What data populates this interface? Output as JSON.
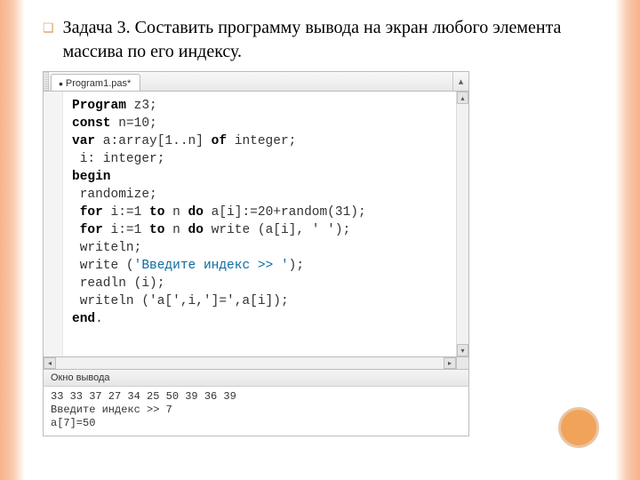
{
  "task": {
    "bullet": "❑",
    "text": "Задача 3. Составить программу вывода на экран любого элемента массива по его индексу."
  },
  "ide": {
    "tab_label": "Program1.pas*",
    "collapse_icon": "▴",
    "scroll_up": "▴",
    "scroll_down": "▾",
    "scroll_left": "◂",
    "scroll_right": "▸",
    "code": {
      "l1": {
        "kw1": "Program",
        "rest": " z3;"
      },
      "l2": {
        "kw1": "const",
        "rest": " n=10;"
      },
      "l3": {
        "kw1": "var",
        "mid": " a:array[1..n] ",
        "kw2": "of",
        "rest": " integer;"
      },
      "l4": {
        "rest": " i: integer;"
      },
      "l5": {
        "kw1": "begin"
      },
      "l6": {
        "rest": " randomize;"
      },
      "l7": {
        "kw1": " for",
        "mid1": " i:=1 ",
        "kw2": "to",
        "mid2": " n ",
        "kw3": "do",
        "rest": " a[i]:=20+random(31);"
      },
      "l8": {
        "kw1": " for",
        "mid1": " i:=1 ",
        "kw2": "to",
        "mid2": " n ",
        "kw3": "do",
        "rest": " write (a[i], ' ');"
      },
      "l9": {
        "rest": " writeln;"
      },
      "l10": {
        "pre": " write (",
        "str": "'Введите индекс >> '",
        "post": ");"
      },
      "l11": {
        "rest": " readln (i);"
      },
      "l12": {
        "rest": " writeln ('a[',i,']=',a[i]);"
      },
      "l13": {
        "kw1": "end",
        "rest": "."
      }
    }
  },
  "output": {
    "title": "Окно вывода",
    "line1": "33 33 37 27 34 25 50 39 36 39",
    "line2": "Введите индекс >> 7",
    "line3": "a[7]=50"
  }
}
